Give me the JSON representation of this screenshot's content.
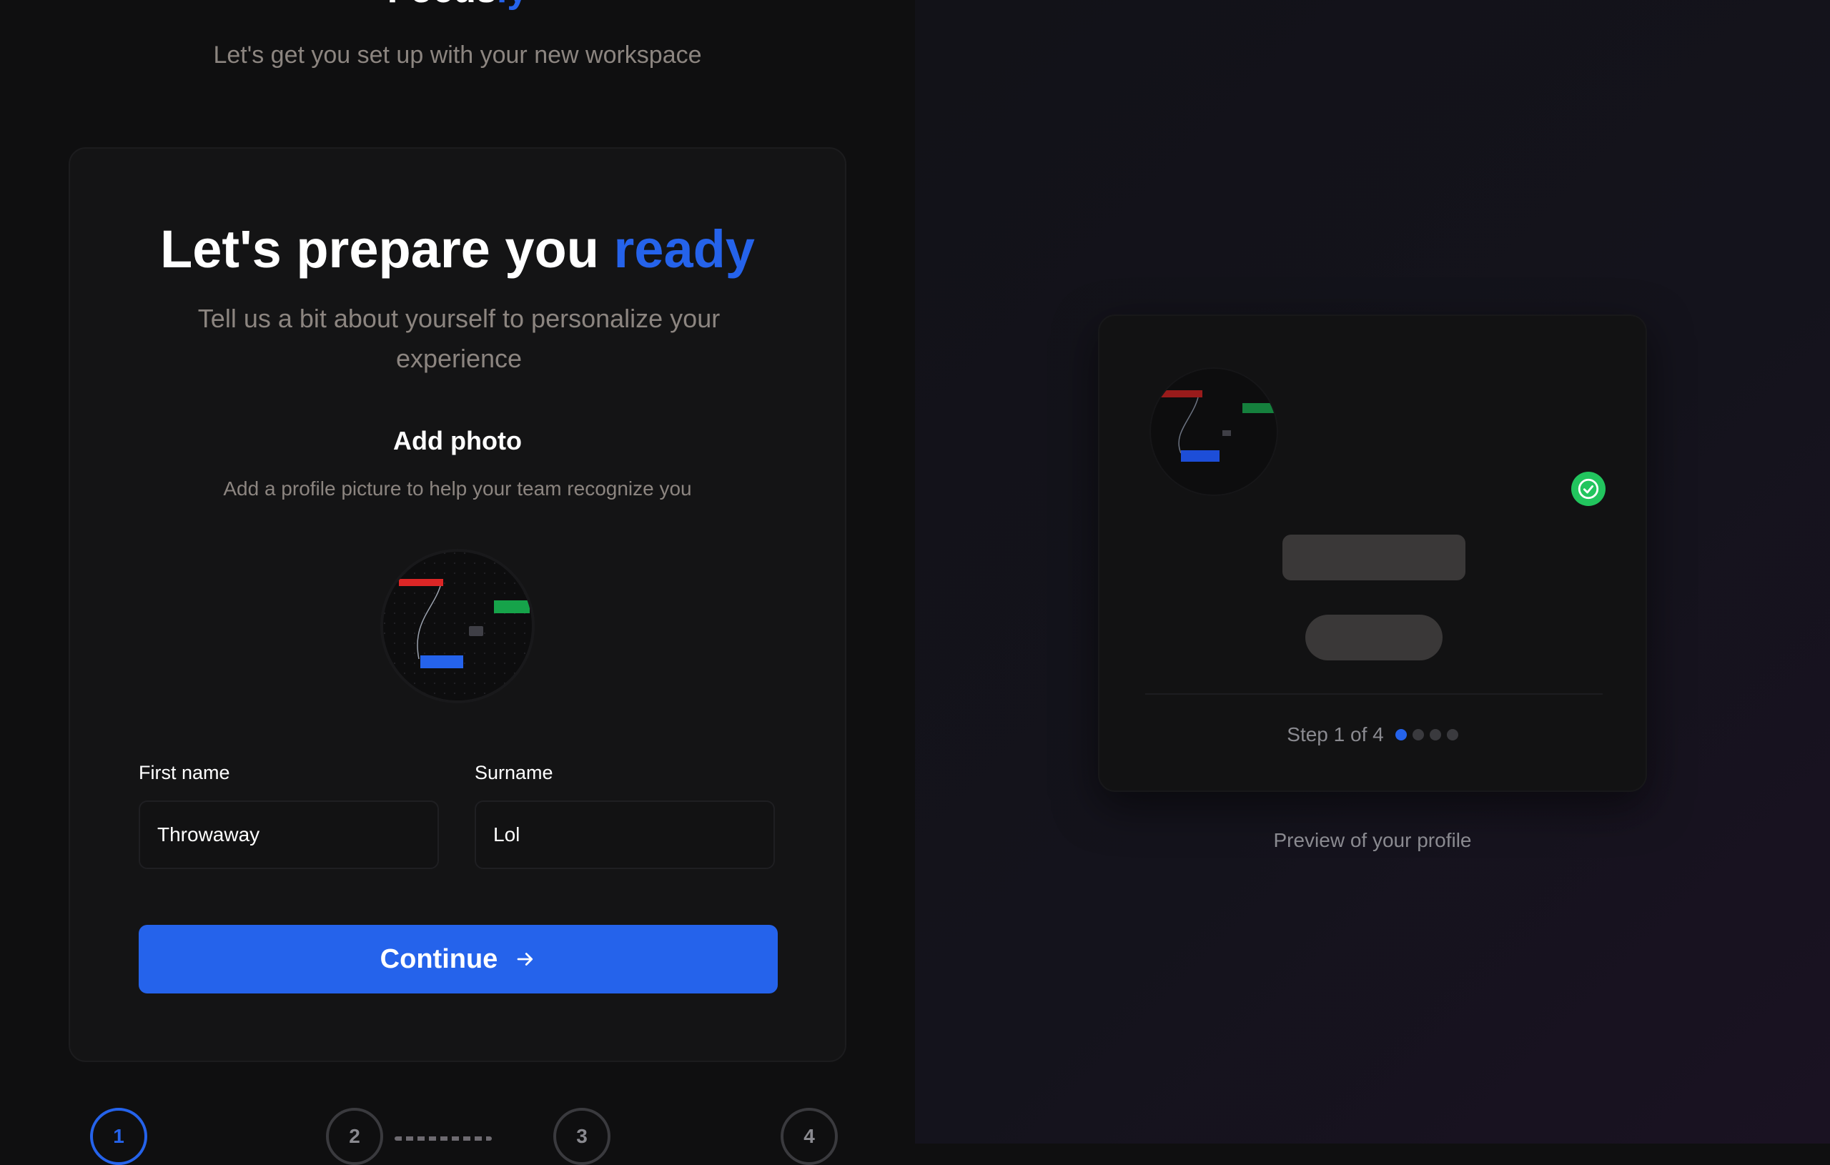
{
  "brand": {
    "name_part1": "Focus",
    "name_part2": "ly"
  },
  "intro": {
    "subtitle": "Let's get you set up with your new workspace"
  },
  "card": {
    "title_main": "Let's prepare you ",
    "title_accent": "ready",
    "subtitle": "Tell us a bit about yourself to personalize your experience"
  },
  "photo": {
    "title": "Add photo",
    "subtitle": "Add a profile picture to help your team recognize you",
    "avatar_icon": "workflow-graph-image"
  },
  "form": {
    "first_name_label": "First name",
    "first_name_value": "Throwaway",
    "surname_label": "Surname",
    "surname_value": "Lol"
  },
  "continue": {
    "label": "Continue",
    "icon": "arrow-right-icon"
  },
  "stepper": {
    "steps": [
      {
        "number": "1",
        "active": true
      },
      {
        "number": "2",
        "active": false
      },
      {
        "number": "3",
        "active": false
      },
      {
        "number": "4",
        "active": false
      }
    ]
  },
  "preview": {
    "step_text": "Step 1 of 4",
    "current_step": 1,
    "total_steps": 4,
    "caption": "Preview of your profile",
    "verified_icon": "check-circle-icon"
  },
  "colors": {
    "accent": "#2563eb",
    "success": "#22c55e",
    "background": "#0f0f10",
    "card": "#141415",
    "muted_text": "#8c8580"
  }
}
